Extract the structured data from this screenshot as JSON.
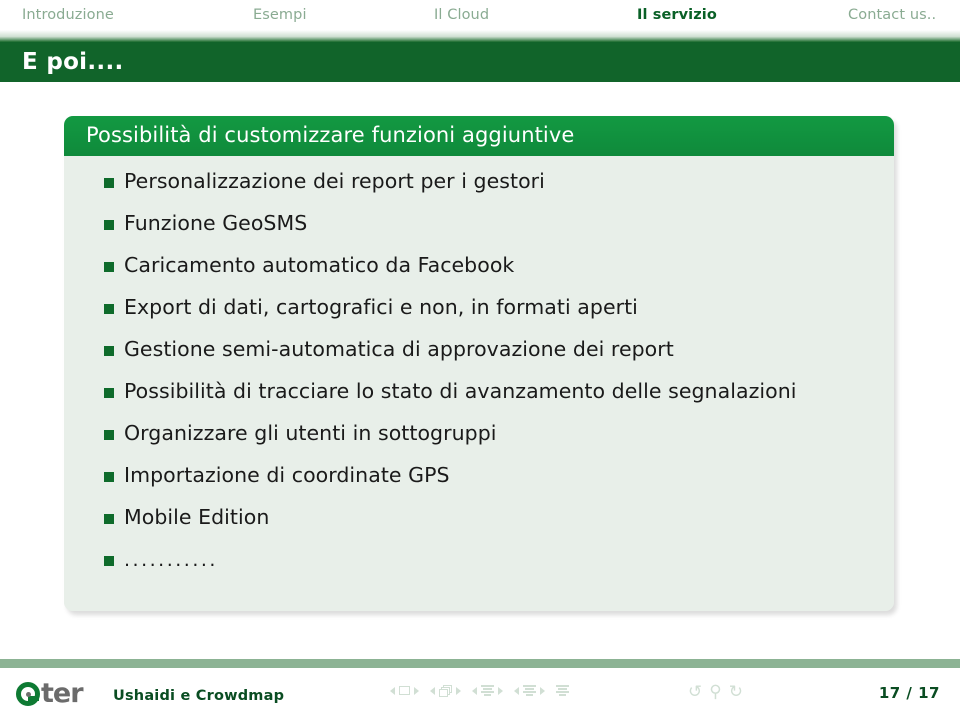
{
  "navbar": {
    "items": [
      {
        "label": "Introduzione",
        "active": false
      },
      {
        "label": "Esempi",
        "active": false
      },
      {
        "label": "Il Cloud",
        "active": false
      },
      {
        "label": "Il servizio",
        "active": true
      },
      {
        "label": "Contact us..",
        "active": false
      }
    ]
  },
  "title": "E poi....",
  "block": {
    "heading": "Possibilità di customizzare funzioni aggiuntive",
    "items": [
      "Personalizzazione dei report per i gestori",
      "Funzione GeoSMS",
      "Caricamento automatico da Facebook",
      "Export di dati, cartografici e non, in formati aperti",
      "Gestione semi-automatica di approvazione dei report",
      "Possibilità di tracciare lo stato di avanzamento delle segnalazioni",
      "Organizzare gli utenti in sottogruppi",
      "Importazione di coordinate GPS",
      "Mobile Edition",
      "..........."
    ]
  },
  "footer": {
    "logo_mark": "G",
    "logo_text": "ter",
    "label": "Ushaidi e Crowdmap",
    "page": "17 / 17",
    "nav_icons": [
      "prev-slide-icon",
      "slide-icon",
      "next-slide-icon",
      "prev-frame-icon",
      "frame-icon",
      "next-frame-icon",
      "prev-subsection-icon",
      "subsection-icon",
      "next-subsection-icon",
      "prev-section-icon",
      "section-icon",
      "next-section-icon",
      "doc-icon",
      "back-icon",
      "search-icon",
      "forward-icon"
    ]
  },
  "colors": {
    "dark_green": "#11642a",
    "block_green": "#139942",
    "sage": "#8cb394",
    "nav_inactive": "#8aab92",
    "block_bg": "#e8efe9"
  }
}
